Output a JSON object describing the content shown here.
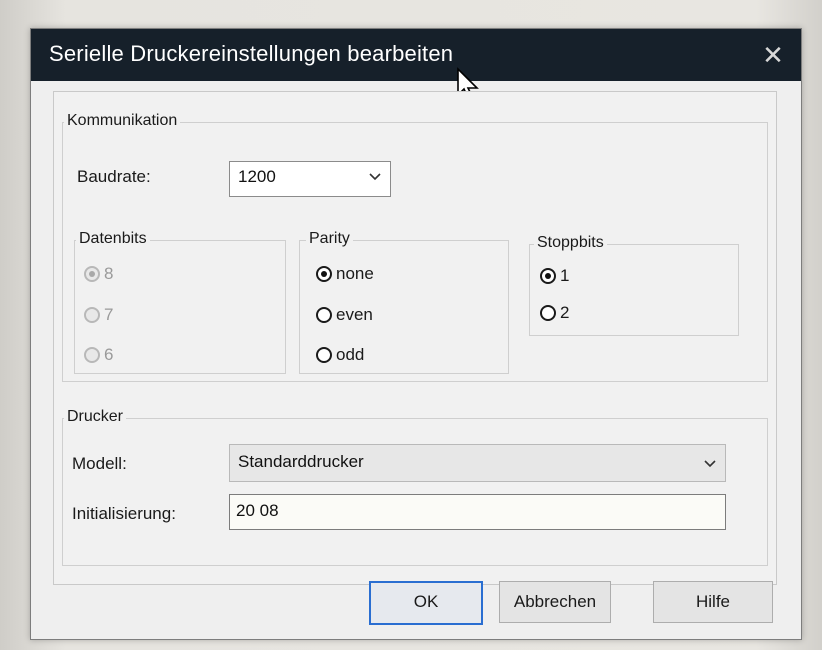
{
  "window": {
    "title": "Serielle Druckereinstellungen bearbeiten",
    "close_glyph": "✕"
  },
  "kommunikation": {
    "group_label": "Kommunikation",
    "baudrate_label": "Baudrate:",
    "baudrate_value": "1200",
    "datenbits": {
      "label": "Datenbits",
      "options": [
        "8",
        "7",
        "6"
      ],
      "selected": "8",
      "enabled": false
    },
    "parity": {
      "label": "Parity",
      "options": [
        "none",
        "even",
        "odd"
      ],
      "selected": "none"
    },
    "stoppbits": {
      "label": "Stoppbits",
      "options": [
        "1",
        "2"
      ],
      "selected": "1"
    }
  },
  "drucker": {
    "group_label": "Drucker",
    "modell_label": "Modell:",
    "modell_value": "Standarddrucker",
    "init_label": "Initialisierung:",
    "init_value": "20 08"
  },
  "buttons": {
    "ok": "OK",
    "cancel": "Abbrechen",
    "help": "Hilfe"
  },
  "icons": {
    "dropdown": "chevron-down-icon",
    "close": "close-icon",
    "cursor": "mouse-pointer-icon"
  }
}
